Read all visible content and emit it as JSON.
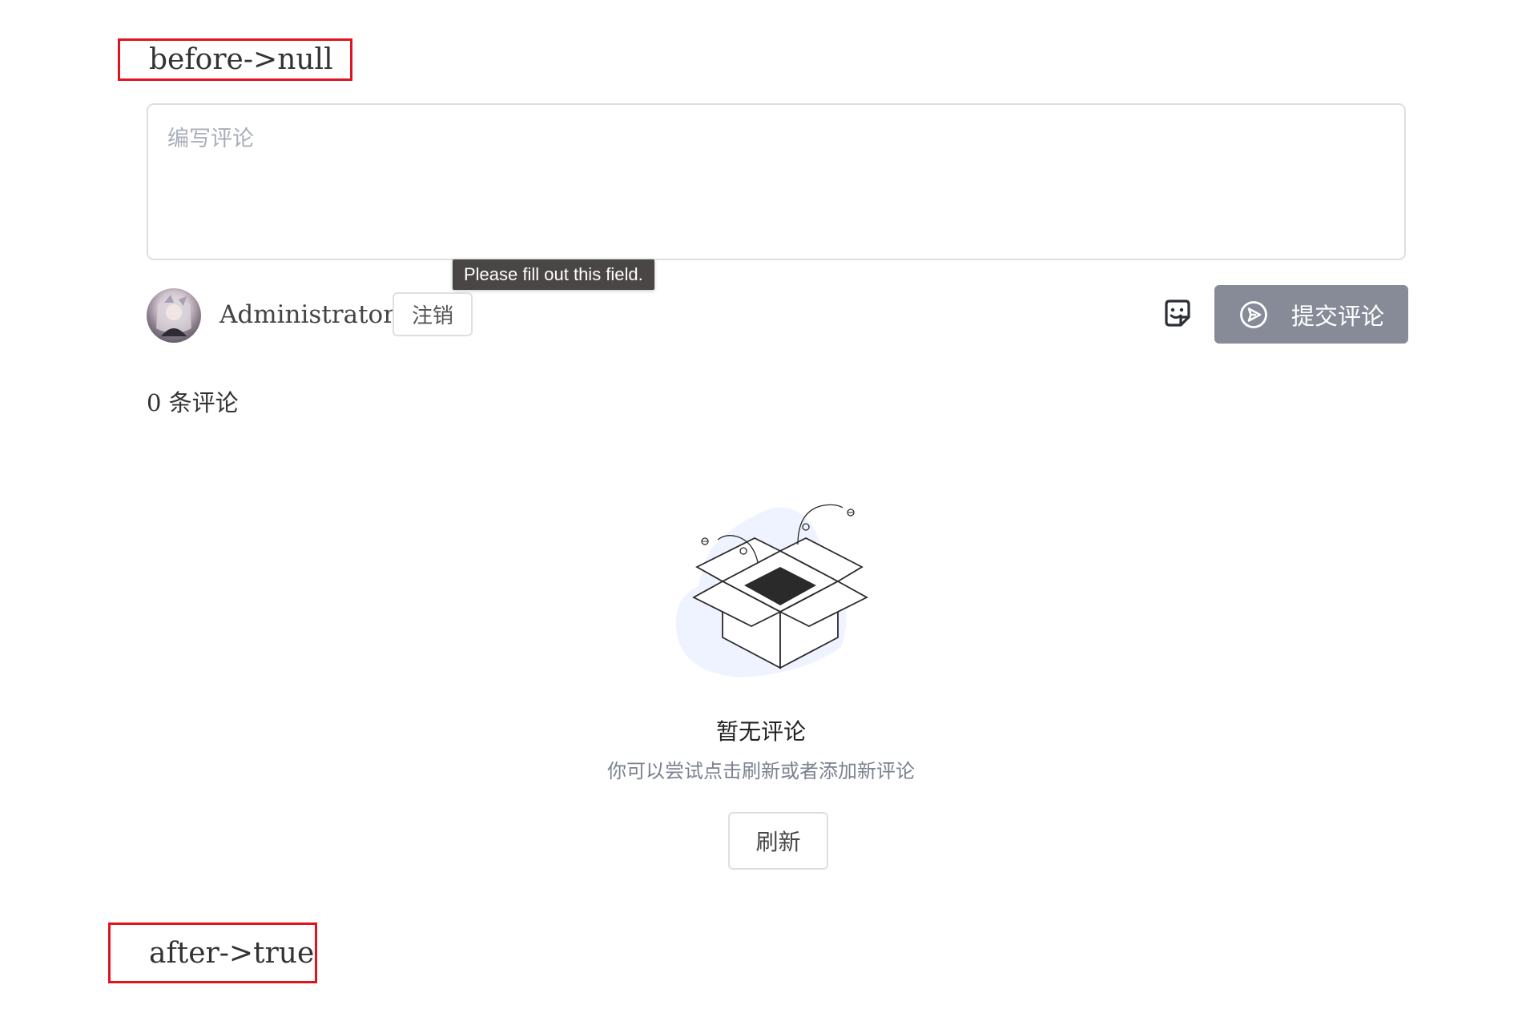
{
  "markers": {
    "before": "before->null",
    "after": "after->true"
  },
  "editor": {
    "placeholder": "编写评论",
    "validation_tooltip": "Please fill out this field."
  },
  "user": {
    "name": "Administrator",
    "logout_label": "注销"
  },
  "actions": {
    "sticker_icon": "sticker-icon",
    "submit_icon": "send-circle-icon",
    "submit_label": "提交评论",
    "submit_bg": "#878b98"
  },
  "comments": {
    "count_label": "0 条评论"
  },
  "empty_state": {
    "illustration": "empty-box-icon",
    "title": "暂无评论",
    "description": "你可以尝试点击刷新或者添加新评论",
    "refresh_label": "刷新"
  }
}
